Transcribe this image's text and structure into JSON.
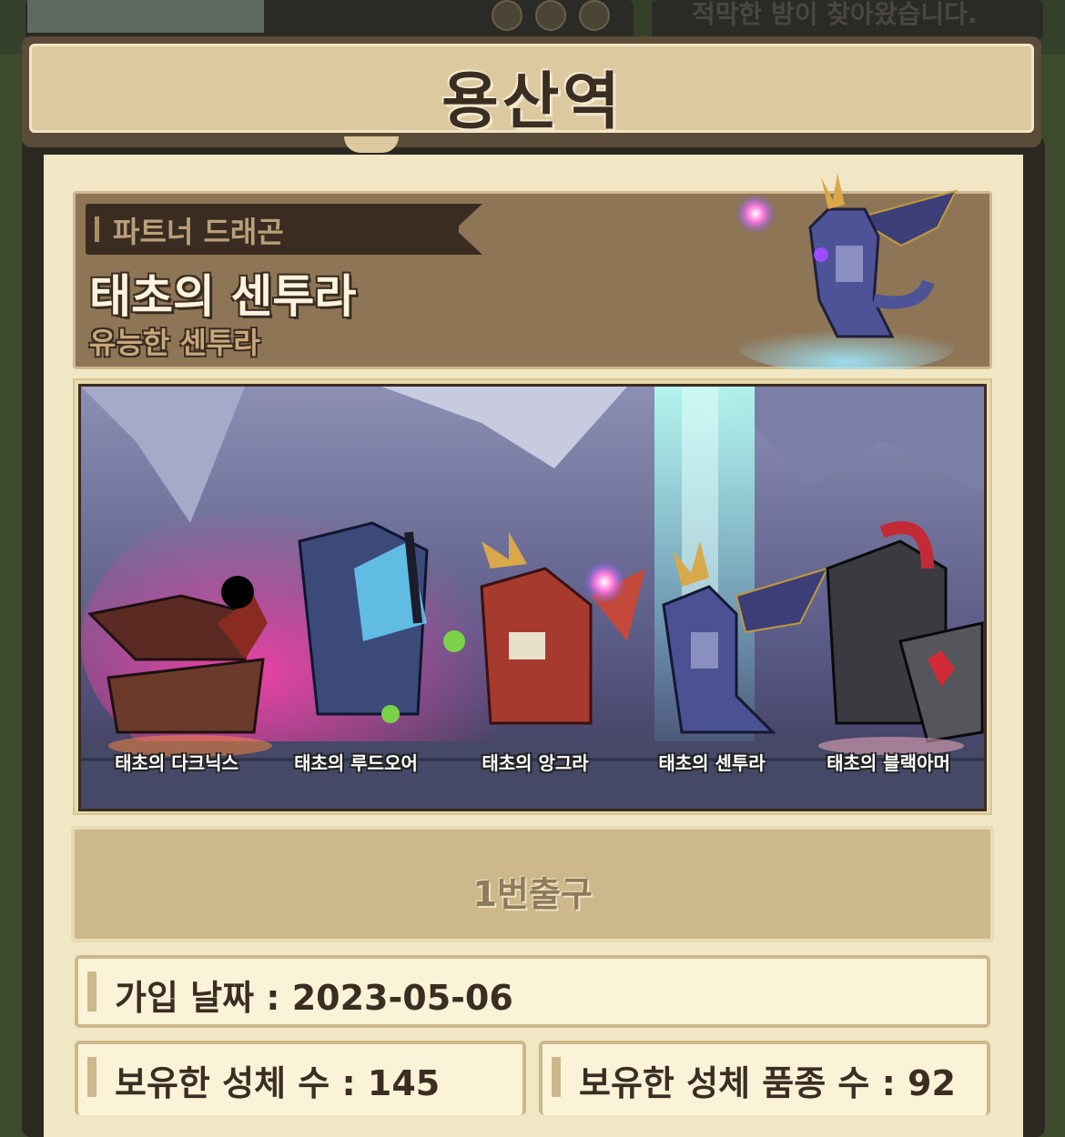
{
  "background": {
    "notice_text": "적막한 밤이 찾아왔습니다."
  },
  "header": {
    "title": "용산역"
  },
  "partner": {
    "ribbon_label": "파트너 드래곤",
    "dragon_name": "태초의 센투라",
    "dragon_subtitle": "유능한 센투라"
  },
  "banner": {
    "dragons": [
      {
        "label": "태초의 다크닉스",
        "color": "#6b3a2a"
      },
      {
        "label": "태초의 루드오어",
        "color": "#3c4a7a"
      },
      {
        "label": "태초의 앙그라",
        "color": "#a63a2e"
      },
      {
        "label": "태초의 센투라",
        "color": "#4a5294"
      },
      {
        "label": "태초의 블랙아머",
        "color": "#3a3a40"
      }
    ]
  },
  "exit": {
    "label": "1번출구"
  },
  "stats": {
    "join_date": "가입 날짜 : 2023-05-06",
    "owned_count": "보유한 성체 수 : 145",
    "owned_species": "보유한 성체 품종 수 : 92"
  }
}
